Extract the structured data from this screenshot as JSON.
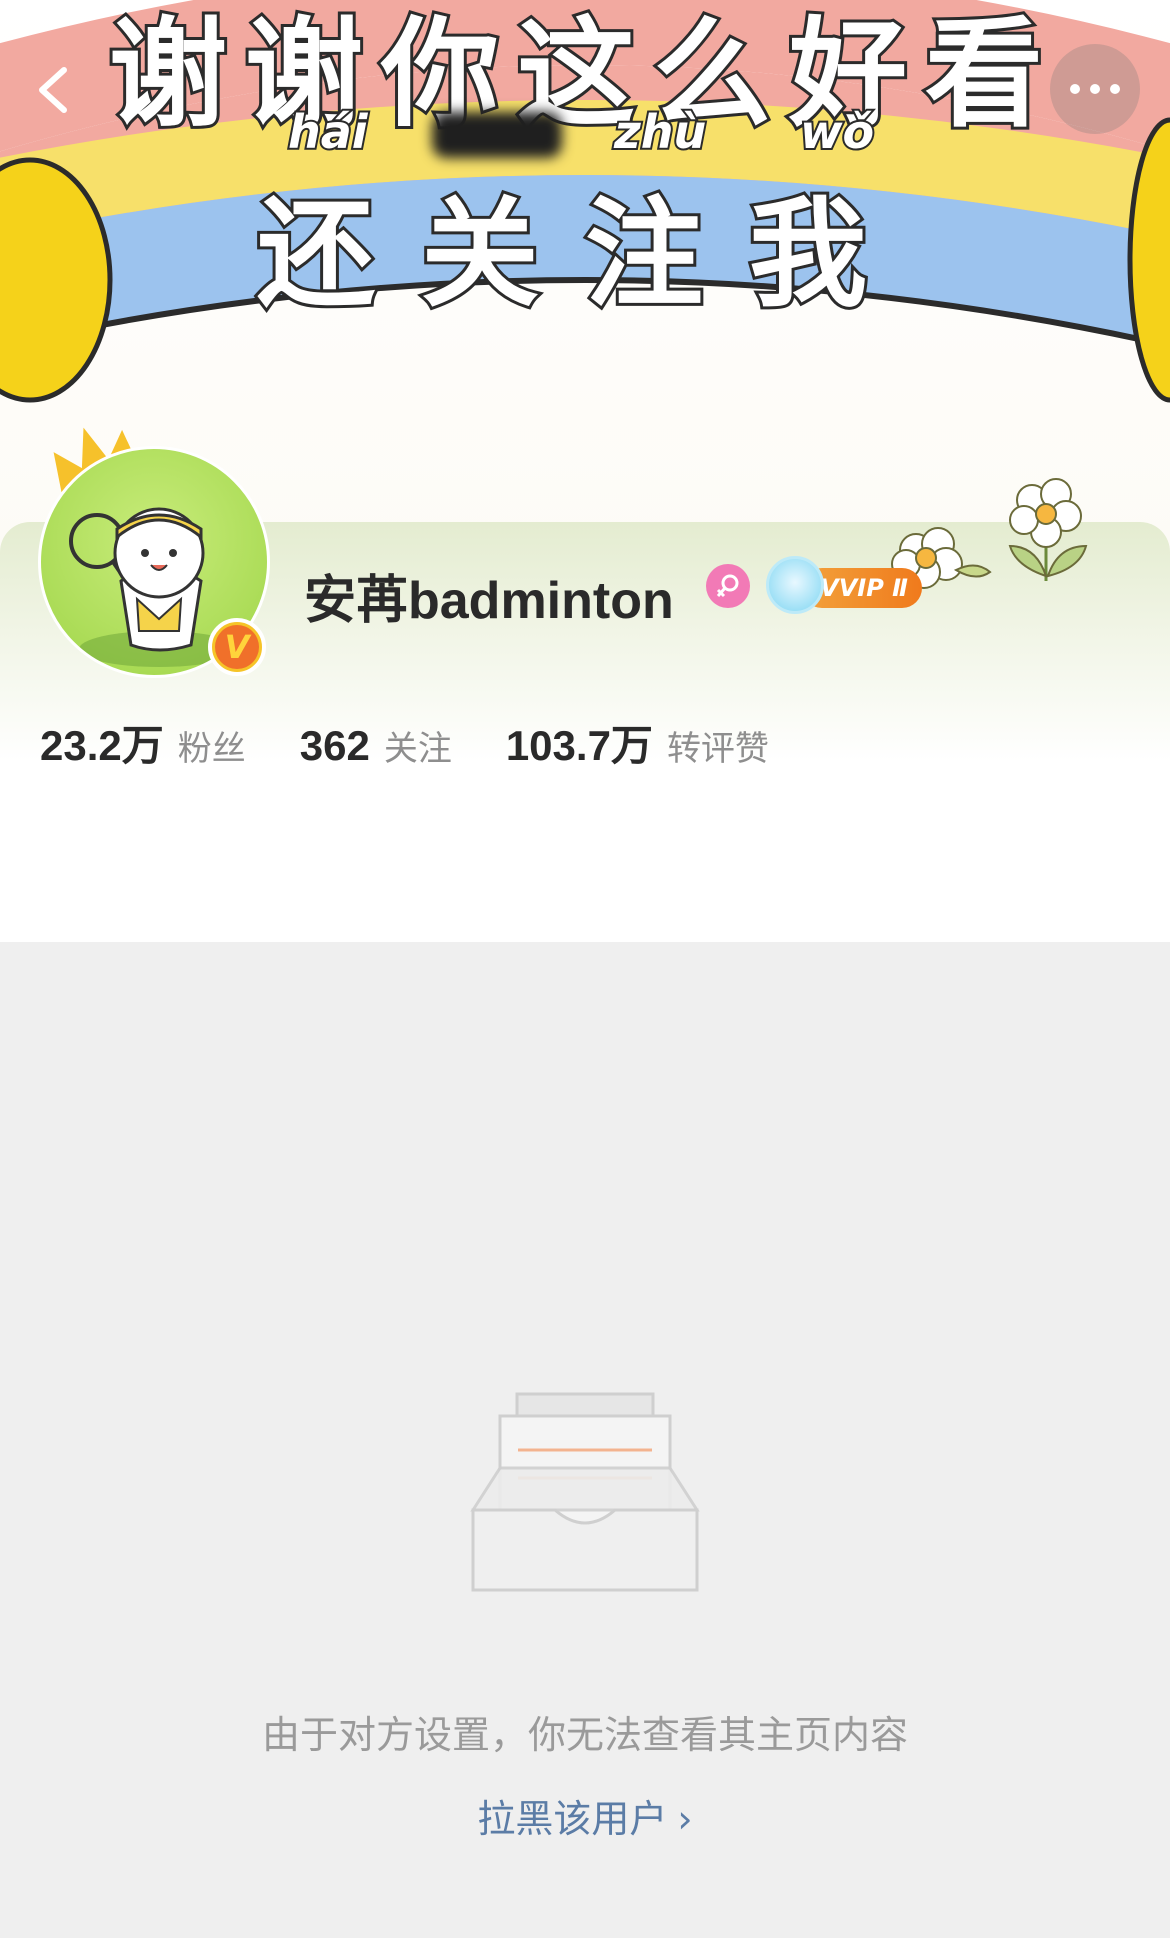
{
  "banner": {
    "line1": "谢谢你这么好看",
    "line2": "还关注我",
    "pinyin": [
      "hái",
      "zhù",
      "wǒ"
    ]
  },
  "profile": {
    "username": "安苒badminton",
    "vip_label": "VVIP Ⅱ",
    "stats": [
      {
        "value": "23.2万",
        "label": "粉丝"
      },
      {
        "value": "362",
        "label": "关注"
      },
      {
        "value": "103.7万",
        "label": "转评赞"
      }
    ]
  },
  "empty_state": {
    "message": "由于对方设置，你无法查看其主页内容",
    "action": "拉黑该用户",
    "action_chevron": "›"
  },
  "colors": {
    "link": "#5b7ca6",
    "badge_orange": "#f0702a",
    "gender_pink": "#f27ab6",
    "page_bg": "#efefef"
  },
  "icons": [
    "back-arrow-icon",
    "more-icon",
    "crown-icon",
    "verified-v-icon",
    "female-icon",
    "vvip-badge-icon",
    "flower-icon",
    "empty-inbox-icon"
  ]
}
